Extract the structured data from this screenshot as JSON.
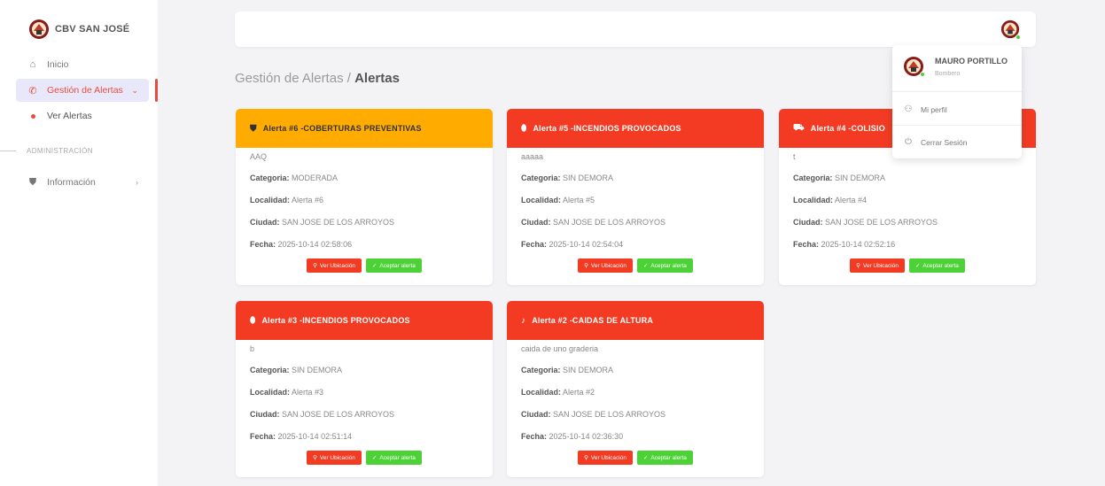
{
  "brand": {
    "name": "CBV SAN JOSÉ"
  },
  "sidebar": {
    "items": [
      {
        "label": "Inicio",
        "icon": "home-icon"
      },
      {
        "label": "Gestión de Alertas",
        "icon": "phone-icon"
      },
      {
        "label": "Ver Alertas",
        "icon": "dot-icon"
      },
      {
        "label": "Información",
        "icon": "shield-icon"
      }
    ],
    "section_admin": "ADMINISTRACIÓN"
  },
  "breadcrumb": {
    "parent": "Gestión de Alertas / ",
    "current": "Alertas"
  },
  "user_menu": {
    "name": "MAURO PORTILLO",
    "role": "Bombero",
    "profile_label": "Mi perfil",
    "logout_label": "Cerrar Sesión"
  },
  "labels": {
    "categoria": "Categoria:",
    "localidad": "Localidad:",
    "ciudad": "Ciudad:",
    "fecha": "Fecha:",
    "ver_ubicacion": "Ver Ubicación",
    "aceptar": "Aceptar alerta"
  },
  "alerts": [
    {
      "title": "Alerta #6 -COBERTURAS PREVENTIVAS",
      "desc": "AAQ",
      "categoria": "MODERADA",
      "localidad": "Alerta #6",
      "ciudad": "SAN JOSE DE LOS ARROYOS",
      "fecha": "2025-10-14 02:58:06",
      "color": "#ffab00",
      "icon": "shield-icon"
    },
    {
      "title": "Alerta #5 -INCENDIOS PROVOCADOS",
      "desc": "aaaaa",
      "categoria": "SIN DEMORA",
      "localidad": "Alerta #5",
      "ciudad": "SAN JOSE DE LOS ARROYOS",
      "fecha": "2025-10-14 02:54:04",
      "color": "#f23b22",
      "icon": "fire-icon"
    },
    {
      "title": "Alerta #4 -COLISIO",
      "desc": "t",
      "categoria": "SIN DEMORA",
      "localidad": "Alerta #4",
      "ciudad": "SAN JOSE DE LOS ARROYOS",
      "fecha": "2025-10-14 02:52:16",
      "color": "#f23b22",
      "icon": "car-crash-icon"
    },
    {
      "title": "Alerta #3 -INCENDIOS PROVOCADOS",
      "desc": "b",
      "categoria": "SIN DEMORA",
      "localidad": "Alerta #3",
      "ciudad": "SAN JOSE DE LOS ARROYOS",
      "fecha": "2025-10-14 02:51:14",
      "color": "#f23b22",
      "icon": "fire-icon"
    },
    {
      "title": "Alerta #2 -CAIDAS DE ALTURA",
      "desc": "caida de uno graderia",
      "categoria": "SIN DEMORA",
      "localidad": "Alerta #2",
      "ciudad": "SAN JOSE DE LOS ARROYOS",
      "fecha": "2025-10-14 02:36:30",
      "color": "#f23b22",
      "icon": "bell-icon"
    }
  ],
  "colors": {
    "accent": "#e74c3c",
    "orange": "#ffab00",
    "red": "#f23b22",
    "green": "#4cd137"
  }
}
